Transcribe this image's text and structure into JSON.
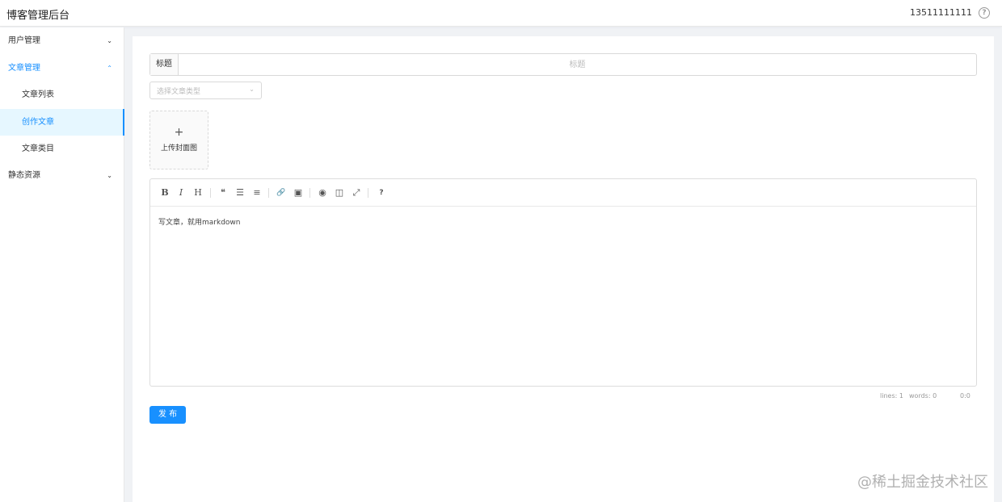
{
  "header": {
    "app_title": "博客管理后台",
    "user_phone": "13511111111",
    "help_icon": "?"
  },
  "sidebar": {
    "items": [
      {
        "label": "用户管理",
        "chevron": "⌄"
      },
      {
        "label": "文章管理",
        "chevron": "⌃"
      },
      {
        "label": "文章列表"
      },
      {
        "label": "创作文章"
      },
      {
        "label": "文章类目"
      },
      {
        "label": "静态资源",
        "chevron": "⌄"
      }
    ]
  },
  "form": {
    "title_addon": "标题",
    "title_placeholder": "标题",
    "category_placeholder": "选择文章类型",
    "upload_plus": "+",
    "upload_label": "上传封面图"
  },
  "editor": {
    "toolbar": {
      "bold": "B",
      "italic": "I",
      "heading": "H",
      "quote": "❝",
      "unordered_list": "☰",
      "ordered_list": "≡",
      "link": "🔗",
      "image": "▣",
      "preview": "◉",
      "side_by_side": "◫",
      "fullscreen": "⤢",
      "guide": "?"
    },
    "content": "写文章，就用markdown",
    "status": {
      "lines": "lines: 1",
      "words": "words: 0",
      "cursor": "0:0"
    }
  },
  "publish_label": "发 布",
  "watermark": "@稀土掘金技术社区"
}
